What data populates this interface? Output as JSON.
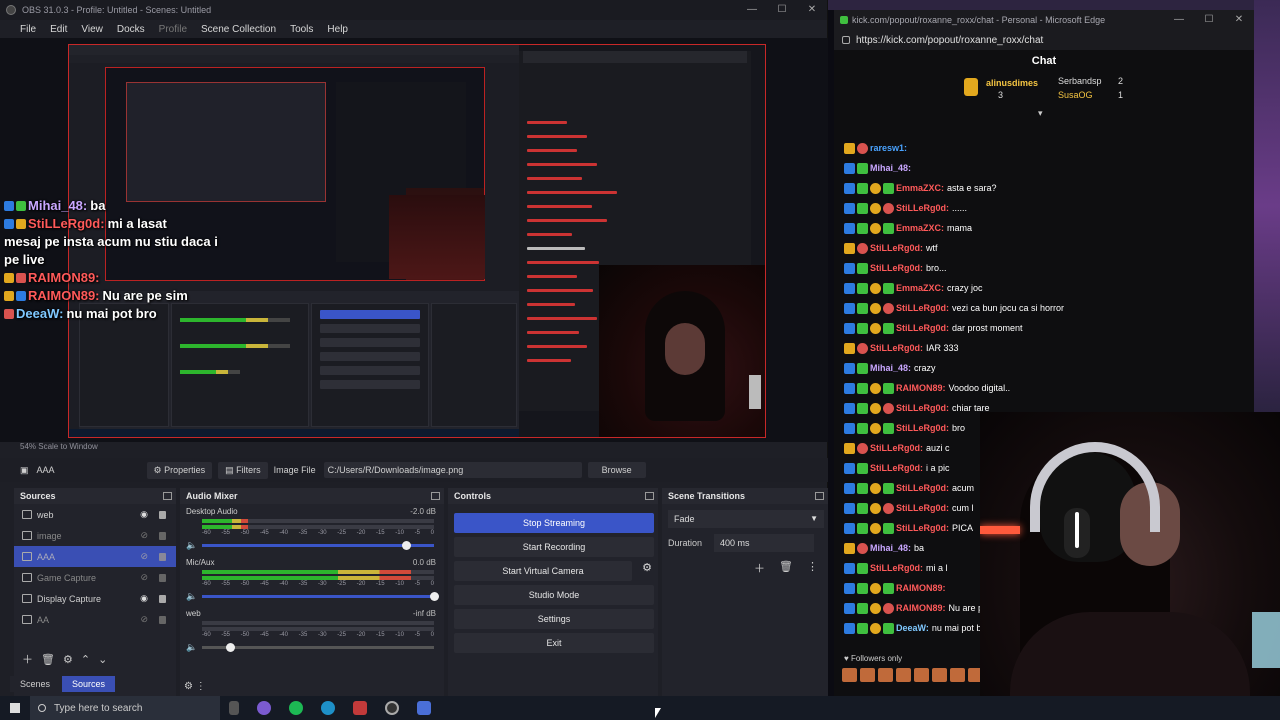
{
  "obs": {
    "title": "OBS 31.0.3 - Profile: Untitled - Scenes: Untitled",
    "menu": [
      "File",
      "Edit",
      "View",
      "Docks",
      "Profile",
      "Scene Collection",
      "Tools",
      "Help"
    ],
    "scale_label": "54%  Scale to Window",
    "overlay_chat": [
      {
        "user": "Mihai_48:",
        "msg": "ba",
        "color": "#c9a7ff"
      },
      {
        "user": "StiLLeRg0d:",
        "msg": "mi a lasat",
        "color": "#ff5a5a"
      },
      {
        "user": "",
        "msg": "mesaj pe insta acum nu stiu daca i",
        "color": "#ffffff"
      },
      {
        "user": "",
        "msg": "pe live",
        "color": "#ffffff"
      },
      {
        "user": "RAIMON89:",
        "msg": "",
        "color": "#ff5a5a"
      },
      {
        "user": "RAIMON89:",
        "msg": "Nu are pe sim",
        "color": "#ff5a5a"
      },
      {
        "user": "DeeaW:",
        "msg": "nu mai pot bro",
        "color": "#7fc8ff"
      }
    ],
    "source_toolbar": {
      "current_source": "AAA",
      "properties": "Properties",
      "filters": "Filters",
      "image_file_label": "Image File",
      "path": "C:/Users/R/Downloads/image.png",
      "browse": "Browse"
    },
    "sources": {
      "title": "Sources",
      "items": [
        {
          "name": "web",
          "visible": true,
          "selected": false
        },
        {
          "name": "image",
          "visible": false,
          "selected": false
        },
        {
          "name": "AAA",
          "visible": false,
          "selected": true
        },
        {
          "name": "Game Capture",
          "visible": false,
          "selected": false
        },
        {
          "name": "Display Capture",
          "visible": true,
          "selected": false
        },
        {
          "name": "AA",
          "visible": false,
          "selected": false
        }
      ]
    },
    "audio_mixer": {
      "title": "Audio Mixer",
      "scale": [
        "-60",
        "-55",
        "-50",
        "-45",
        "-40",
        "-35",
        "-30",
        "-25",
        "-20",
        "-15",
        "-10",
        "-5",
        "0"
      ],
      "channels": [
        {
          "name": "Desktop Audio",
          "db": "-2.0 dB",
          "level": 0.2,
          "fader": 0.88
        },
        {
          "name": "Mic/Aux",
          "db": "0.0 dB",
          "level": 0.9,
          "fader": 1.0
        },
        {
          "name": "web",
          "db": "-inf dB",
          "level": 0.0,
          "fader": 0.12
        }
      ]
    },
    "controls": {
      "title": "Controls",
      "buttons": [
        "Stop Streaming",
        "Start Recording",
        "Start Virtual Camera",
        "Studio Mode",
        "Settings",
        "Exit"
      ]
    },
    "scene_transitions": {
      "title": "Scene Transitions",
      "transition": "Fade",
      "duration_label": "Duration",
      "duration": "400 ms"
    },
    "bottom_tabs": [
      "Scenes",
      "Sources"
    ]
  },
  "edge": {
    "title": "kick.com/popout/roxanne_roxx/chat - Personal - Microsoft Edge",
    "url": "https://kick.com/popout/roxanne_roxx/chat",
    "chat_title": "Chat",
    "leaderboard": [
      {
        "name": "alinusdimes",
        "count": "3"
      },
      {
        "name": "Serbandsp",
        "count": "2"
      },
      {
        "name": "SusaOG",
        "count": "1"
      }
    ],
    "messages": [
      {
        "user": "raresw1:",
        "msg": "",
        "color": "#4aa3ff"
      },
      {
        "user": "Mihai_48:",
        "msg": "",
        "color": "#c9a7ff"
      },
      {
        "user": "EmmaZXC:",
        "msg": "asta e sara?",
        "color": "#ff5a5a"
      },
      {
        "user": "StiLLeRg0d:",
        "msg": "......",
        "color": "#ff5a5a"
      },
      {
        "user": "EmmaZXC:",
        "msg": "mama",
        "color": "#ff5a5a"
      },
      {
        "user": "StiLLeRg0d:",
        "msg": "wtf",
        "color": "#ff5a5a"
      },
      {
        "user": "StiLLeRg0d:",
        "msg": "bro...",
        "color": "#ff5a5a"
      },
      {
        "user": "EmmaZXC:",
        "msg": "crazy joc",
        "color": "#ff5a5a"
      },
      {
        "user": "StiLLeRg0d:",
        "msg": "vezi ca bun jocu ca si horror",
        "color": "#ff5a5a"
      },
      {
        "user": "StiLLeRg0d:",
        "msg": "dar prost moment",
        "color": "#ff5a5a"
      },
      {
        "user": "StiLLeRg0d:",
        "msg": "IAR 333",
        "color": "#ff5a5a"
      },
      {
        "user": "Mihai_48:",
        "msg": "crazy",
        "color": "#c9a7ff"
      },
      {
        "user": "RAIMON89:",
        "msg": "Voodoo digital..",
        "color": "#ff5a5a"
      },
      {
        "user": "StiLLeRg0d:",
        "msg": "chiar tare",
        "color": "#ff5a5a"
      },
      {
        "user": "StiLLeRg0d:",
        "msg": "bro",
        "color": "#ff5a5a"
      },
      {
        "user": "StiLLeRg0d:",
        "msg": "auzi c",
        "color": "#ff5a5a"
      },
      {
        "user": "StiLLeRg0d:",
        "msg": "i a pic",
        "color": "#ff5a5a"
      },
      {
        "user": "StiLLeRg0d:",
        "msg": "acum",
        "color": "#ff5a5a"
      },
      {
        "user": "StiLLeRg0d:",
        "msg": "cum l",
        "color": "#ff5a5a"
      },
      {
        "user": "StiLLeRg0d:",
        "msg": "PICA",
        "color": "#ff5a5a"
      },
      {
        "user": "Mihai_48:",
        "msg": "ba",
        "color": "#c9a7ff"
      },
      {
        "user": "StiLLeRg0d:",
        "msg": "mi a l",
        "color": "#ff5a5a"
      },
      {
        "user": "RAIMON89:",
        "msg": "",
        "color": "#ff5a5a"
      },
      {
        "user": "RAIMON89:",
        "msg": "Nu are pe",
        "color": "#ff5a5a"
      },
      {
        "user": "DeeaW:",
        "msg": "nu mai pot bro",
        "color": "#7fc8ff"
      }
    ],
    "followers_only": "Followers only"
  },
  "taskbar": {
    "search_placeholder": "Type here to search"
  }
}
